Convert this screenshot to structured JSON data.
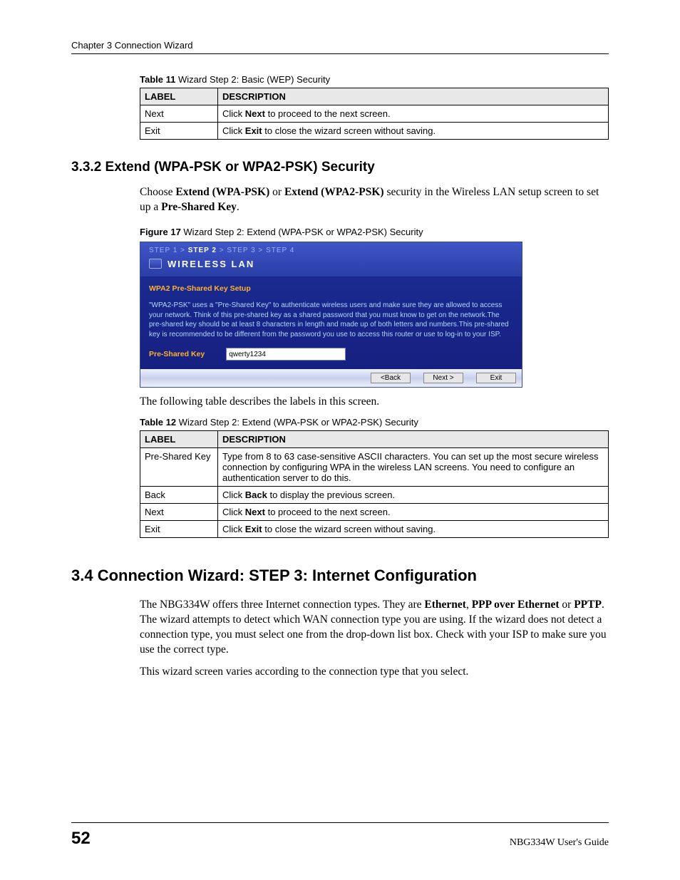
{
  "header": {
    "chapter": "Chapter 3 Connection Wizard"
  },
  "table11": {
    "caption_bold": "Table 11",
    "caption_rest": "   Wizard Step 2: Basic (WEP) Security",
    "head_label": "LABEL",
    "head_desc": "DESCRIPTION",
    "rows": [
      {
        "label": "Next",
        "desc_pre": "Click ",
        "desc_bold": "Next",
        "desc_post": " to proceed to the next screen."
      },
      {
        "label": "Exit",
        "desc_pre": "Click ",
        "desc_bold": "Exit",
        "desc_post": " to close the wizard screen without saving."
      }
    ]
  },
  "section332": {
    "heading": "3.3.2  Extend (WPA-PSK or WPA2-PSK) Security",
    "p1_a": "Choose ",
    "p1_b1": "Extend (WPA-PSK)",
    "p1_c": " or ",
    "p1_b2": "Extend (WPA2-PSK)",
    "p1_d": " security in the Wireless LAN setup screen to set up a ",
    "p1_b3": "Pre-Shared Key",
    "p1_e": "."
  },
  "figure17": {
    "caption_bold": "Figure 17",
    "caption_rest": "   Wizard Step 2: Extend (WPA-PSK or WPA2-PSK) Security"
  },
  "wizard": {
    "steps": {
      "s1": "STEP 1",
      "sep": " > ",
      "s2": "STEP 2",
      "s3": "STEP 3",
      "s4": "STEP 4"
    },
    "title": "WIRELESS LAN",
    "setup_title": "WPA2 Pre-Shared Key Setup",
    "help_text": "\"WPA2-PSK\" uses a \"Pre-Shared Key\" to authenticate wireless users and make sure they are allowed to access your network. Think of this pre-shared key as a shared password that you must know to get on the network.The pre-shared key should be at least 8 characters in length and made up of both letters and numbers.This pre-shared key is recommended to be different from the password you use to access this router or use to log-in to your ISP.",
    "psk_label": "Pre-Shared Key",
    "psk_value": "qwerty1234",
    "btn_back": "<Back",
    "btn_next": "Next >",
    "btn_exit": "Exit"
  },
  "after_figure_text": "The following table describes the labels in this screen.",
  "table12": {
    "caption_bold": "Table 12",
    "caption_rest": "   Wizard Step 2: Extend (WPA-PSK or WPA2-PSK) Security",
    "head_label": "LABEL",
    "head_desc": "DESCRIPTION",
    "rows": [
      {
        "label": "Pre-Shared Key",
        "desc_pre": "Type from 8 to 63 case-sensitive ASCII characters. You can set up the most secure wireless connection by configuring WPA in the wireless LAN screens. You need to configure an authentication server to do this.",
        "desc_bold": "",
        "desc_post": ""
      },
      {
        "label": "Back",
        "desc_pre": "Click ",
        "desc_bold": "Back",
        "desc_post": " to display the previous screen."
      },
      {
        "label": "Next",
        "desc_pre": "Click ",
        "desc_bold": "Next",
        "desc_post": " to proceed to the next screen."
      },
      {
        "label": "Exit",
        "desc_pre": "Click ",
        "desc_bold": "Exit",
        "desc_post": " to close the wizard screen without saving."
      }
    ]
  },
  "section34": {
    "heading": "3.4  Connection Wizard: STEP 3: Internet Configuration",
    "p1_a": "The NBG334W offers three Internet connection types. They are ",
    "p1_b1": "Ethernet",
    "p1_c": ", ",
    "p1_b2": "PPP over Ethernet",
    "p1_d": " or ",
    "p1_b3": "PPTP",
    "p1_e": ". The wizard attempts to detect which WAN connection type you are using. If the wizard does not detect a connection type, you must select one from the drop-down list box. Check with your ISP to make sure you use the correct type.",
    "p2": "This wizard screen varies according to the connection type that you select."
  },
  "footer": {
    "page": "52",
    "guide": "NBG334W User's Guide"
  }
}
